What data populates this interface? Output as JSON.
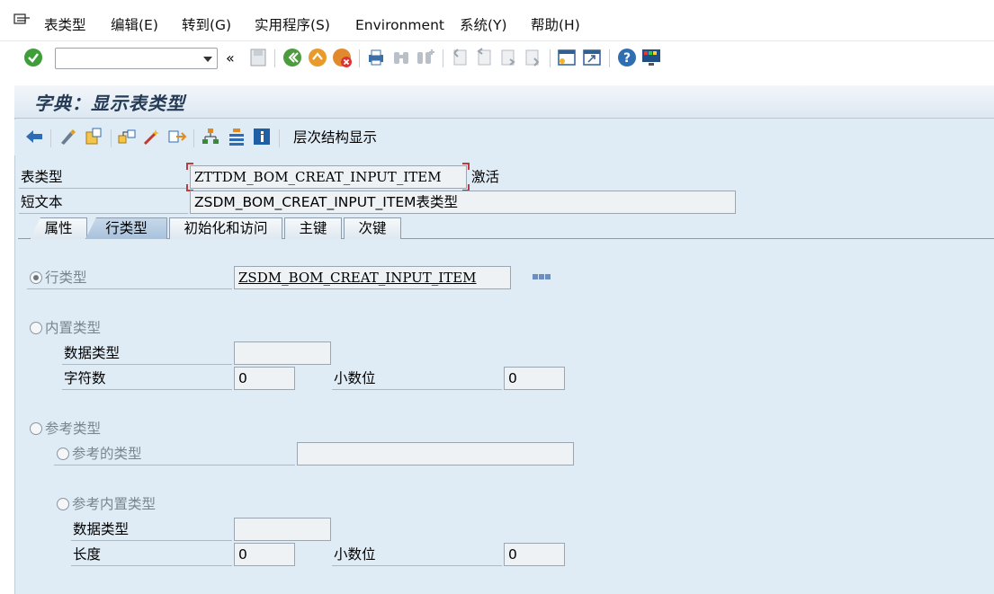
{
  "menu": {
    "items": [
      "表类型",
      "编辑(E)",
      "转到(G)",
      "实用程序(S)",
      "Environment",
      "系统(Y)",
      "帮助(H)"
    ]
  },
  "toolbar": {
    "command_value": "",
    "history_back": "«",
    "icons": [
      "enter-icon",
      "save-icon",
      "back-icon",
      "exit-icon",
      "cancel-icon",
      "print-icon",
      "find-icon",
      "find-next-icon",
      "first-page-icon",
      "prev-page-icon",
      "next-page-icon",
      "last-page-icon",
      "new-session-icon",
      "shortcut-icon",
      "help-icon",
      "layout-icon"
    ]
  },
  "title": "字典：显示表类型",
  "app_toolbar": {
    "hierarchy_label": "层次结构显示"
  },
  "header": {
    "table_type_label": "表类型",
    "table_type_value": "ZTTDM_BOM_CREAT_INPUT_ITEM",
    "status": "激活",
    "short_text_label": "短文本",
    "short_text_value": "ZSDM_BOM_CREAT_INPUT_ITEM表类型"
  },
  "tabs": [
    {
      "label": "属性"
    },
    {
      "label": "行类型"
    },
    {
      "label": "初始化和访问"
    },
    {
      "label": "主键"
    },
    {
      "label": "次键"
    }
  ],
  "row_type": {
    "option_row_type": "行类型",
    "row_type_value": "ZSDM_BOM_CREAT_INPUT_ITEM",
    "option_builtin": "内置类型",
    "data_type_label": "数据类型",
    "data_type_value": "",
    "chars_label": "字符数",
    "chars_value": "0",
    "decimals_label": "小数位",
    "decimals_value": "0",
    "option_reference": "参考类型",
    "option_ref_type": "参考的类型",
    "ref_type_value": "",
    "option_ref_builtin": "参考内置类型",
    "ref_data_type_label": "数据类型",
    "ref_data_type_value": "",
    "length_label": "长度",
    "length_value": "0",
    "ref_decimals_label": "小数位",
    "ref_decimals_value": "0"
  }
}
